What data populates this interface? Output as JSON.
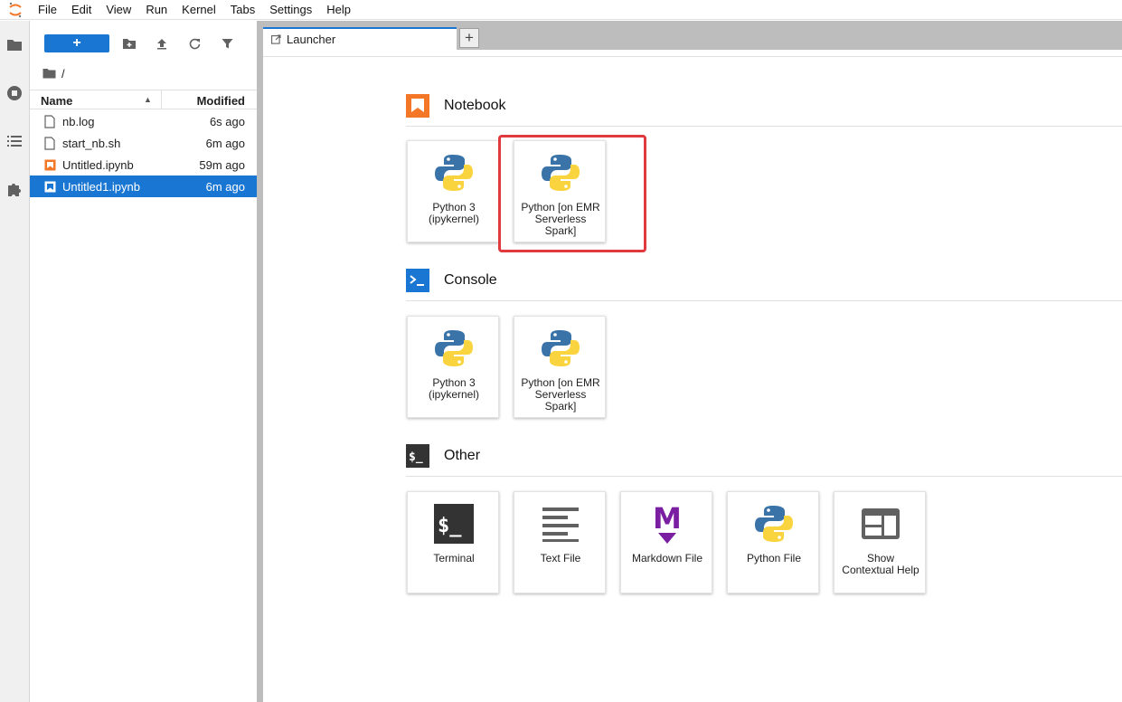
{
  "menu": [
    "File",
    "Edit",
    "View",
    "Run",
    "Kernel",
    "Tabs",
    "Settings",
    "Help"
  ],
  "file_browser": {
    "new_button": "+",
    "breadcrumb": "/",
    "columns": {
      "name": "Name",
      "modified": "Modified"
    },
    "files": [
      {
        "name": "nb.log",
        "modified": "6s ago",
        "icon": "file-icon"
      },
      {
        "name": "start_nb.sh",
        "modified": "6m ago",
        "icon": "file-icon"
      },
      {
        "name": "Untitled.ipynb",
        "modified": "59m ago",
        "icon": "notebook-icon"
      },
      {
        "name": "Untitled1.ipynb",
        "modified": "6m ago",
        "icon": "notebook-icon",
        "selected": true
      }
    ]
  },
  "tabs": {
    "launcher": "Launcher",
    "add": "+"
  },
  "launcher": {
    "notebook": {
      "title": "Notebook",
      "cards": [
        "Python 3\n(ipykernel)",
        "Python [on EMR\nServerless\nSpark]"
      ]
    },
    "console": {
      "title": "Console",
      "cards": [
        "Python 3\n(ipykernel)",
        "Python [on EMR\nServerless\nSpark]"
      ]
    },
    "other": {
      "title": "Other",
      "cards": [
        "Terminal",
        "Text File",
        "Markdown File",
        "Python File",
        "Show\nContextual Help"
      ]
    }
  },
  "colors": {
    "accent": "#1976d2",
    "notebook_orange": "#f37726",
    "markdown_purple": "#7b1fa2",
    "highlight_red": "#e0393e"
  }
}
